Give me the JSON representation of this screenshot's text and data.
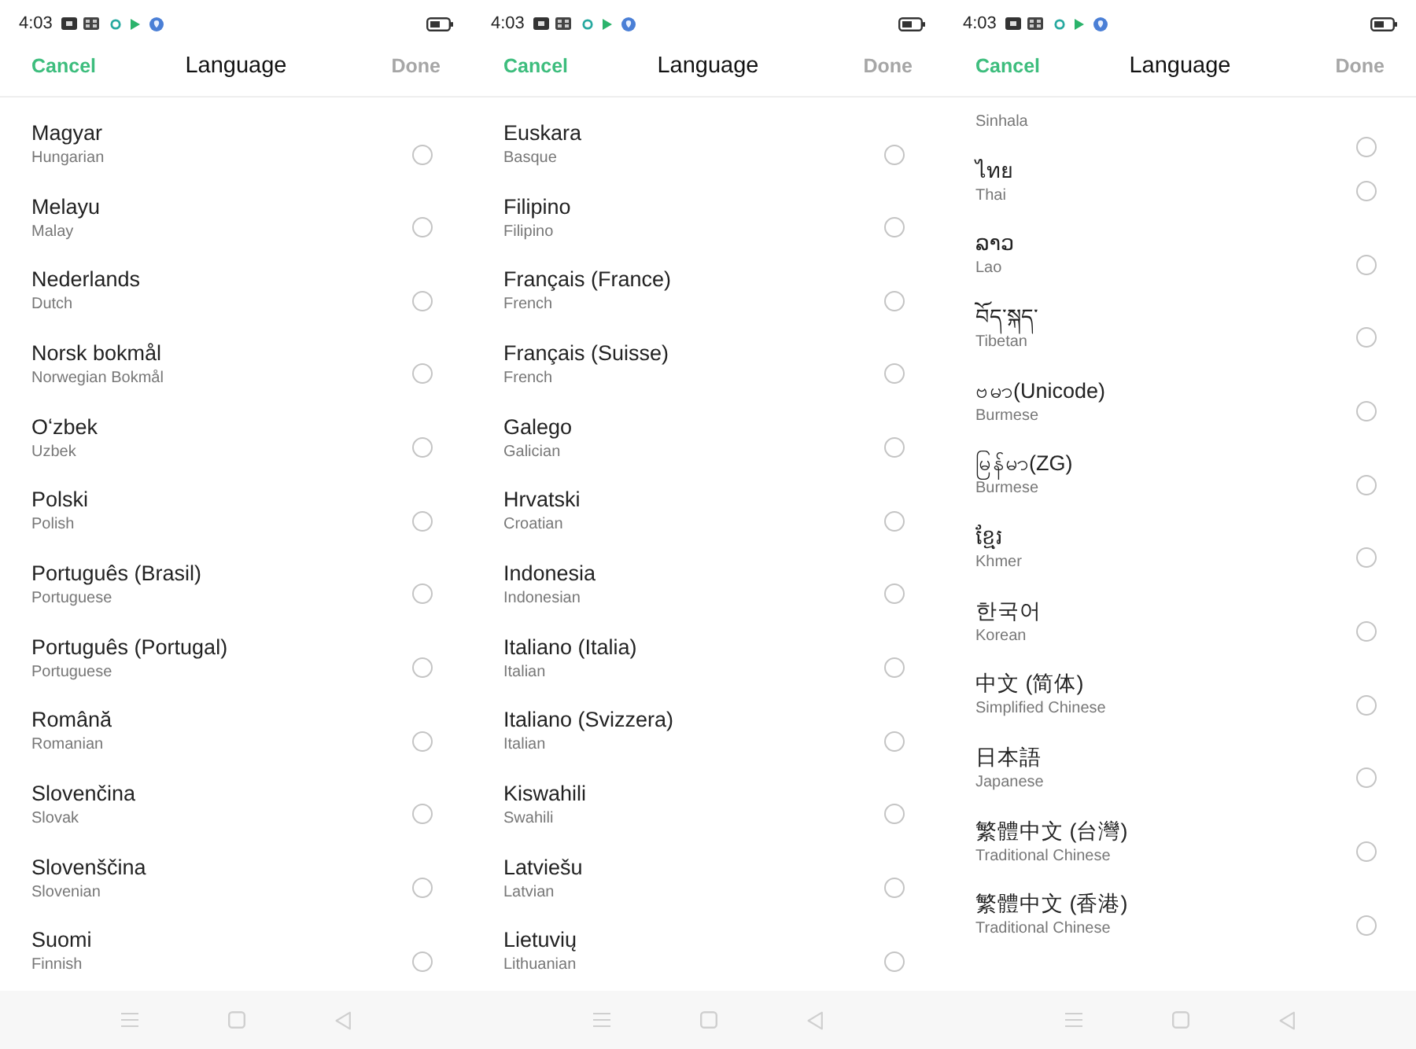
{
  "screens": [
    {
      "status_bar": {
        "time": "4:03"
      },
      "header": {
        "cancel": "Cancel",
        "title": "Language",
        "done": {
          "label": "Done",
          "disabled": true
        }
      },
      "languages": [
        {
          "name": "Magyar",
          "subtitle": "Hungarian",
          "selected": false
        },
        {
          "name": "Melayu",
          "subtitle": "Malay",
          "selected": false
        },
        {
          "name": "Nederlands",
          "subtitle": "Dutch",
          "selected": false
        },
        {
          "name": "Norsk bokmål",
          "subtitle": "Norwegian Bokmål",
          "selected": false
        },
        {
          "name": "Oʻzbek",
          "subtitle": "Uzbek",
          "selected": false
        },
        {
          "name": "Polski",
          "subtitle": "Polish",
          "selected": false
        },
        {
          "name": "Português (Brasil)",
          "subtitle": "Portuguese",
          "selected": false
        },
        {
          "name": "Português (Portugal)",
          "subtitle": "Portuguese",
          "selected": false
        },
        {
          "name": "Română",
          "subtitle": "Romanian",
          "selected": false
        },
        {
          "name": "Slovenčina",
          "subtitle": "Slovak",
          "selected": false
        },
        {
          "name": "Slovenščina",
          "subtitle": "Slovenian",
          "selected": false
        },
        {
          "name": "Suomi",
          "subtitle": "Finnish",
          "selected": false
        }
      ]
    },
    {
      "status_bar": {
        "time": "4:03"
      },
      "header": {
        "cancel": "Cancel",
        "title": "Language",
        "done": {
          "label": "Done",
          "disabled": true
        }
      },
      "languages": [
        {
          "name": "Euskara",
          "subtitle": "Basque",
          "selected": false
        },
        {
          "name": "Filipino",
          "subtitle": "Filipino",
          "selected": false
        },
        {
          "name": "Français (France)",
          "subtitle": "French",
          "selected": false
        },
        {
          "name": "Français (Suisse)",
          "subtitle": "French",
          "selected": false
        },
        {
          "name": "Galego",
          "subtitle": "Galician",
          "selected": false
        },
        {
          "name": "Hrvatski",
          "subtitle": "Croatian",
          "selected": false
        },
        {
          "name": "Indonesia",
          "subtitle": "Indonesian",
          "selected": false
        },
        {
          "name": "Italiano (Italia)",
          "subtitle": "Italian",
          "selected": false
        },
        {
          "name": "Italiano (Svizzera)",
          "subtitle": "Italian",
          "selected": false
        },
        {
          "name": "Kiswahili",
          "subtitle": "Swahili",
          "selected": false
        },
        {
          "name": "Latviešu",
          "subtitle": "Latvian",
          "selected": false
        },
        {
          "name": "Lietuvių",
          "subtitle": "Lithuanian",
          "selected": false
        }
      ]
    },
    {
      "status_bar": {
        "time": "4:03"
      },
      "header": {
        "cancel": "Cancel",
        "title": "Language",
        "done": {
          "label": "Done",
          "disabled": true
        }
      },
      "languages": [
        {
          "subtitle": "Sinhala",
          "selected": false
        },
        {
          "name": "ไทย",
          "subtitle": "Thai",
          "selected": false
        },
        {
          "name": "ລາວ",
          "subtitle": "Lao",
          "selected": false
        },
        {
          "name": "བོད་སྐད་",
          "subtitle": "Tibetan",
          "selected": false
        },
        {
          "name": "ဗမာ(Unicode)",
          "subtitle": "Burmese",
          "selected": false
        },
        {
          "name": "မြန်မာ(ZG)",
          "subtitle": "Burmese",
          "selected": false
        },
        {
          "name": "ខ្មែរ",
          "subtitle": "Khmer",
          "selected": false
        },
        {
          "name": "한국어",
          "subtitle": "Korean",
          "selected": false
        },
        {
          "name": "中文 (简体)",
          "subtitle": "Simplified Chinese",
          "selected": false
        },
        {
          "name": "日本語",
          "subtitle": "Japanese",
          "selected": false
        },
        {
          "name": "繁體中文 (台灣)",
          "subtitle": "Traditional Chinese",
          "selected": false
        },
        {
          "name": "繁體中文 (香港)",
          "subtitle": "Traditional Chinese",
          "selected": false
        }
      ]
    }
  ]
}
